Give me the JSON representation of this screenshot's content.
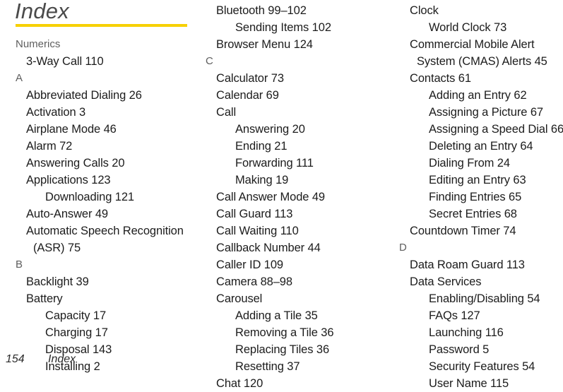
{
  "page": {
    "title": "Index",
    "rule_color": "#f7d000",
    "text_color": "#1c1c1c",
    "letter_color": "#5e5e5e"
  },
  "footer": {
    "page_number": "154",
    "label": "Index"
  },
  "columns": [
    {
      "id": "column-1",
      "lines": [
        {
          "type": "letter",
          "text": "Numerics"
        },
        {
          "type": "entry",
          "text": "3-Way Call 110"
        },
        {
          "type": "letter",
          "text": "A"
        },
        {
          "type": "entry",
          "text": "Abbreviated Dialing 26"
        },
        {
          "type": "entry",
          "text": "Activation 3"
        },
        {
          "type": "entry",
          "text": "Airplane Mode 46"
        },
        {
          "type": "entry",
          "text": "Alarm 72"
        },
        {
          "type": "entry",
          "text": "Answering Calls 20"
        },
        {
          "type": "entry",
          "text": "Applications 123"
        },
        {
          "type": "subentry",
          "text": "Downloading 121"
        },
        {
          "type": "entry",
          "text": "Auto-Answer 49"
        },
        {
          "type": "entry",
          "text": "Automatic Speech Recognition"
        },
        {
          "type": "contline",
          "text": "(ASR) 75"
        },
        {
          "type": "letter",
          "text": "B"
        },
        {
          "type": "entry",
          "text": "Backlight 39"
        },
        {
          "type": "entry",
          "text": "Battery"
        },
        {
          "type": "subentry",
          "text": "Capacity 17"
        },
        {
          "type": "subentry",
          "text": "Charging 17"
        },
        {
          "type": "subentry",
          "text": "Disposal 143"
        },
        {
          "type": "subentry",
          "text": "Installing 2"
        }
      ]
    },
    {
      "id": "column-2",
      "lines": [
        {
          "type": "entry",
          "text": "Bluetooth 99–102"
        },
        {
          "type": "subentry",
          "text": "Sending Items 102"
        },
        {
          "type": "entry",
          "text": "Browser Menu 124"
        },
        {
          "type": "letter",
          "text": "C"
        },
        {
          "type": "entry",
          "text": "Calculator 73"
        },
        {
          "type": "entry",
          "text": "Calendar 69"
        },
        {
          "type": "entry",
          "text": "Call"
        },
        {
          "type": "subentry",
          "text": "Answering 20"
        },
        {
          "type": "subentry",
          "text": "Ending 21"
        },
        {
          "type": "subentry",
          "text": "Forwarding 111"
        },
        {
          "type": "subentry",
          "text": "Making 19"
        },
        {
          "type": "entry",
          "text": "Call Answer Mode 49"
        },
        {
          "type": "entry",
          "text": "Call Guard 113"
        },
        {
          "type": "entry",
          "text": "Call Waiting 110"
        },
        {
          "type": "entry",
          "text": "Callback Number 44"
        },
        {
          "type": "entry",
          "text": "Caller ID 109"
        },
        {
          "type": "entry",
          "text": "Camera 88–98"
        },
        {
          "type": "entry",
          "text": "Carousel"
        },
        {
          "type": "subentry",
          "text": "Adding a Tile 35"
        },
        {
          "type": "subentry",
          "text": "Removing a Tile 36"
        },
        {
          "type": "subentry",
          "text": "Replacing Tiles 36"
        },
        {
          "type": "subentry",
          "text": "Resetting 37"
        },
        {
          "type": "entry",
          "text": "Chat 120"
        }
      ]
    },
    {
      "id": "column-3",
      "lines": [
        {
          "type": "entry",
          "text": "Clock"
        },
        {
          "type": "subentry",
          "text": "World Clock 73"
        },
        {
          "type": "entry",
          "text": "Commercial Mobile Alert"
        },
        {
          "type": "contline",
          "text": "System (CMAS) Alerts 45"
        },
        {
          "type": "entry",
          "text": "Contacts 61"
        },
        {
          "type": "subentry",
          "text": "Adding an Entry 62"
        },
        {
          "type": "subentry",
          "text": "Assigning a Picture 67"
        },
        {
          "type": "subentry",
          "text": "Assigning a Speed Dial 66"
        },
        {
          "type": "subentry",
          "text": "Deleting an Entry 64"
        },
        {
          "type": "subentry",
          "text": "Dialing From 24"
        },
        {
          "type": "subentry",
          "text": "Editing an Entry 63"
        },
        {
          "type": "subentry",
          "text": "Finding Entries 65"
        },
        {
          "type": "subentry",
          "text": "Secret Entries 68"
        },
        {
          "type": "entry",
          "text": "Countdown Timer 74"
        },
        {
          "type": "letter",
          "text": "D"
        },
        {
          "type": "entry",
          "text": "Data Roam Guard 113"
        },
        {
          "type": "entry",
          "text": "Data Services"
        },
        {
          "type": "subentry",
          "text": "Enabling/Disabling 54"
        },
        {
          "type": "subentry",
          "text": "FAQs 127"
        },
        {
          "type": "subentry",
          "text": "Launching 116"
        },
        {
          "type": "subentry",
          "text": "Password 5"
        },
        {
          "type": "subentry",
          "text": "Security Features 54"
        },
        {
          "type": "subentry",
          "text": "User Name 115"
        }
      ]
    }
  ]
}
